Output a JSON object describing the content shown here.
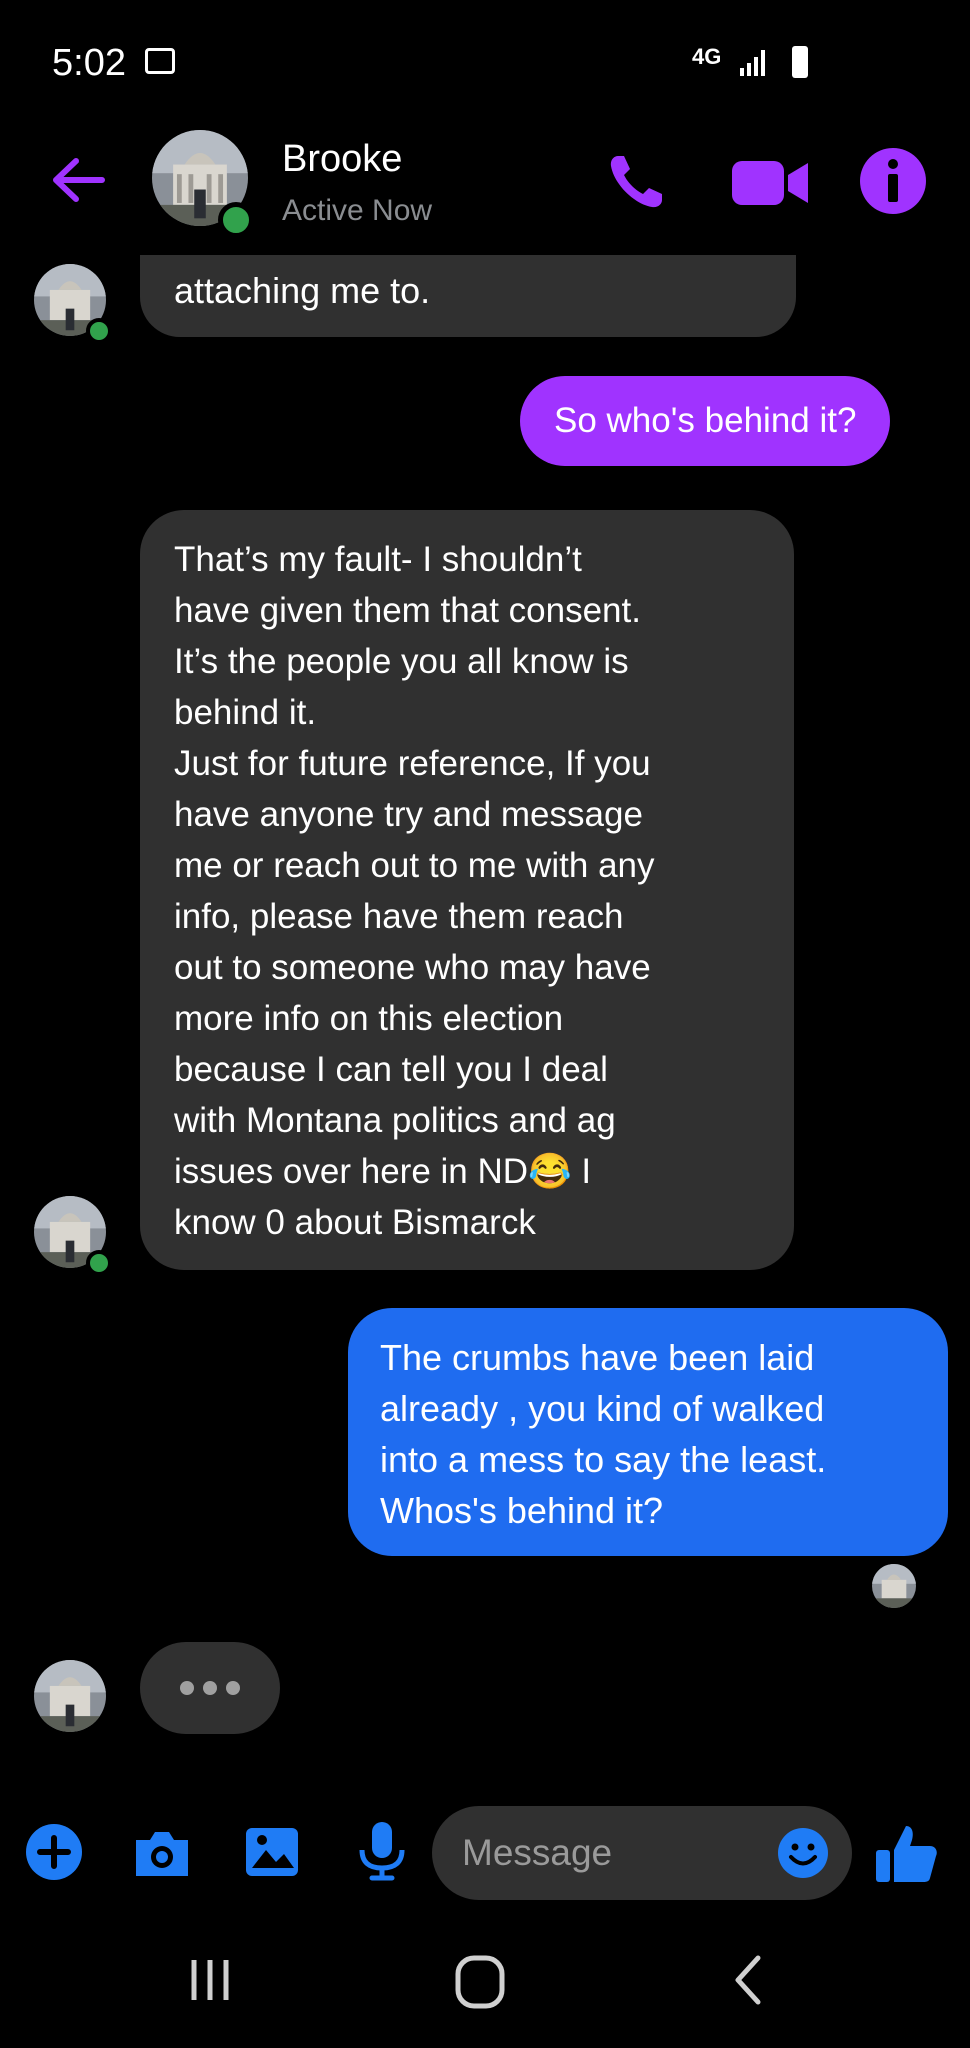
{
  "status_bar": {
    "time": "5:02",
    "network": "4G",
    "icons": [
      "gallery-icon",
      "signal-icon",
      "battery-icon"
    ]
  },
  "header": {
    "contact_name": "Brooke",
    "status": "Active Now",
    "actions": [
      "back-arrow-icon",
      "phone-icon",
      "video-camera-icon",
      "info-icon"
    ]
  },
  "messages": [
    {
      "from": "contact",
      "text": "attaching me to."
    },
    {
      "from": "me",
      "text": "So who's behind it?"
    },
    {
      "from": "contact",
      "text": "That’s my fault- I shouldn’t\nhave given them that consent.\nIt’s the people you all know is\nbehind it.\nJust for future reference, If you\nhave anyone try and message\nme or reach out to me with any\ninfo, please have them reach\nout to someone who may have\nmore info on this election\nbecause I can tell you I deal\nwith Montana politics and ag\nissues over here in ND",
      "emoji": "😂",
      "text_after": " I\nknow 0 about Bismarck"
    },
    {
      "from": "me",
      "text": "The crumbs have been laid\nalready , you kind of walked\ninto a mess to say the least.\nWhos's behind it?"
    }
  ],
  "composer": {
    "placeholder": "Message",
    "icons": [
      "plus-icon",
      "camera-icon",
      "gallery-icon",
      "microphone-icon",
      "emoji-icon",
      "thumbs-up-icon"
    ]
  },
  "colors": {
    "accent_purple": "#a033ff",
    "accent_blue": "#1f6cf0",
    "incoming_bubble": "#303030",
    "online_green": "#31a24c"
  }
}
